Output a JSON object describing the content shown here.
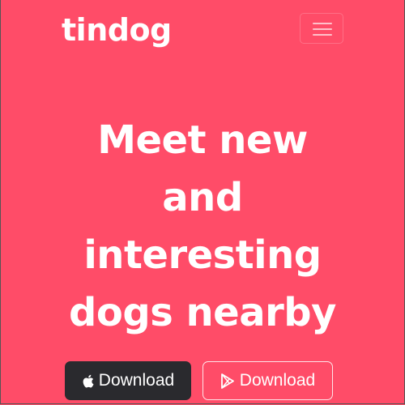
{
  "navbar": {
    "brand": "tindog"
  },
  "hero": {
    "headline_lines": [
      "Meet new",
      "and",
      "interesting",
      "dogs nearby"
    ]
  },
  "buttons": {
    "apple": {
      "label": "Download",
      "icon": "apple-icon"
    },
    "play": {
      "label": "Download",
      "icon": "play-store-icon"
    }
  },
  "colors": {
    "background": "#ff4c68",
    "dark_button": "#2a2a2e",
    "text": "#ffffff"
  }
}
